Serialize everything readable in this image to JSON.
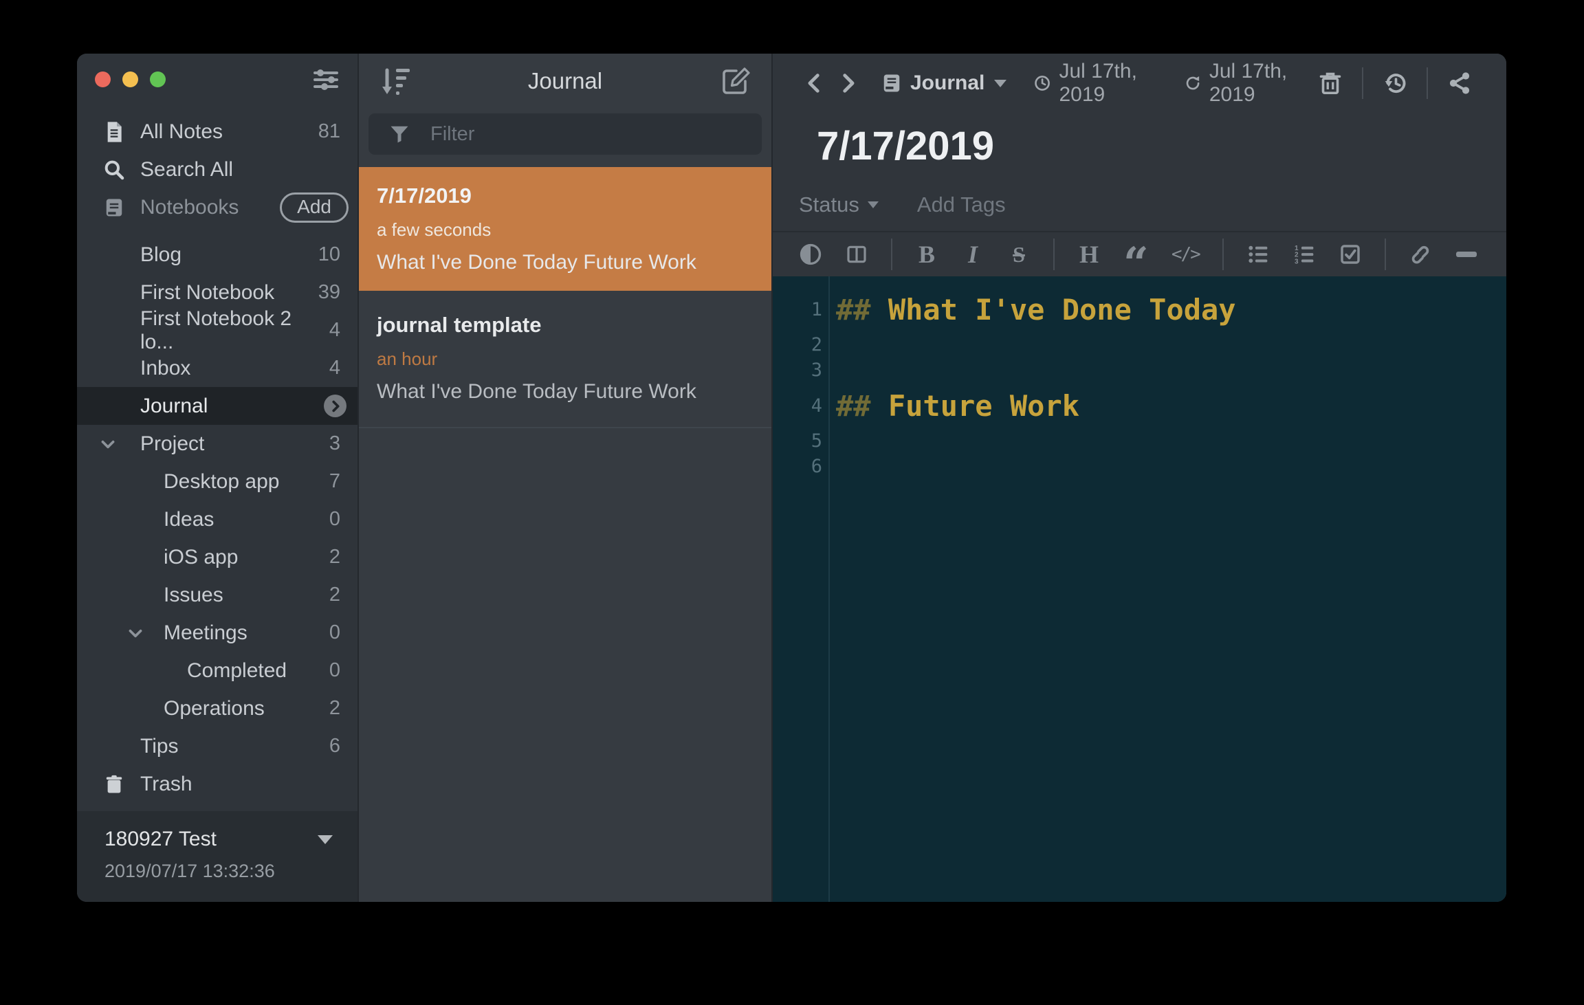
{
  "sidebar": {
    "items": [
      {
        "label": "All Notes",
        "count": "81"
      },
      {
        "label": "Search All",
        "count": ""
      },
      {
        "label": "Notebooks",
        "count": "",
        "action": "Add"
      },
      {
        "label": "Blog",
        "count": "10"
      },
      {
        "label": "First Notebook",
        "count": "39"
      },
      {
        "label": "First Notebook 2 lo...",
        "count": "4"
      },
      {
        "label": "Inbox",
        "count": "4"
      },
      {
        "label": "Journal",
        "count": "",
        "selected": true
      },
      {
        "label": "Project",
        "count": "3",
        "expanded": true
      },
      {
        "label": "Desktop app",
        "count": "7"
      },
      {
        "label": "Ideas",
        "count": "0"
      },
      {
        "label": "iOS app",
        "count": "2"
      },
      {
        "label": "Issues",
        "count": "2"
      },
      {
        "label": "Meetings",
        "count": "0",
        "expanded": true
      },
      {
        "label": "Completed",
        "count": "0"
      },
      {
        "label": "Operations",
        "count": "2"
      },
      {
        "label": "Tips",
        "count": "6"
      },
      {
        "label": "Trash",
        "count": ""
      }
    ],
    "footer": {
      "workspace": "180927 Test",
      "timestamp": "2019/07/17 13:32:36"
    }
  },
  "notelist": {
    "title": "Journal",
    "filter_placeholder": "Filter",
    "notes": [
      {
        "title": "7/17/2019",
        "time": "a few seconds",
        "snippet": "What I've Done Today Future Work",
        "selected": true
      },
      {
        "title": "journal template",
        "time": "an hour",
        "snippet": "What I've Done Today Future Work",
        "selected": false
      }
    ]
  },
  "editor": {
    "notebook": "Journal",
    "created_date": "Jul 17th, 2019",
    "updated_date": "Jul 17th, 2019",
    "title": "7/17/2019",
    "status_label": "Status",
    "add_tags_label": "Add Tags",
    "lines": [
      {
        "num": "1",
        "hash": "##",
        "text": " What I've Done Today"
      },
      {
        "num": "2",
        "hash": "",
        "text": ""
      },
      {
        "num": "3",
        "hash": "",
        "text": ""
      },
      {
        "num": "4",
        "hash": "##",
        "text": " Future Work"
      },
      {
        "num": "5",
        "hash": "",
        "text": ""
      },
      {
        "num": "6",
        "hash": "",
        "text": ""
      }
    ]
  },
  "colors": {
    "accent_orange": "#c57c45",
    "heading_gold": "#c7a33c",
    "editor_background": "#0d2a34",
    "traffic_red": "#ec6a5d",
    "traffic_yellow": "#f4bf50",
    "traffic_green": "#62c454"
  }
}
